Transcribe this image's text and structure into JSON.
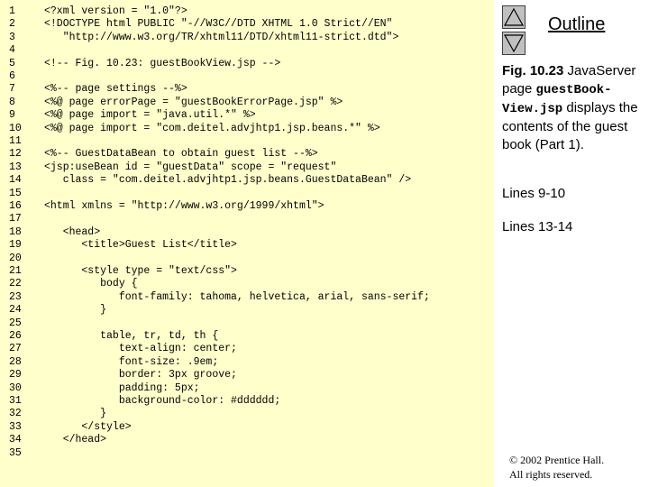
{
  "code": {
    "lines": [
      {
        "n": "1",
        "t": "<?xml version = \"1.0\"?>"
      },
      {
        "n": "2",
        "t": "<!DOCTYPE html PUBLIC \"-//W3C//DTD XHTML 1.0 Strict//EN\""
      },
      {
        "n": "3",
        "t": "   \"http://www.w3.org/TR/xhtml11/DTD/xhtml11-strict.dtd\">"
      },
      {
        "n": "4",
        "t": ""
      },
      {
        "n": "5",
        "t": "<!-- Fig. 10.23: guestBookView.jsp -->"
      },
      {
        "n": "6",
        "t": ""
      },
      {
        "n": "7",
        "t": "<%-- page settings --%>"
      },
      {
        "n": "8",
        "t": "<%@ page errorPage = \"guestBookErrorPage.jsp\" %>"
      },
      {
        "n": "9",
        "t": "<%@ page import = \"java.util.*\" %>"
      },
      {
        "n": "10",
        "t": "<%@ page import = \"com.deitel.advjhtp1.jsp.beans.*\" %>"
      },
      {
        "n": "11",
        "t": ""
      },
      {
        "n": "12",
        "t": "<%-- GuestDataBean to obtain guest list --%>"
      },
      {
        "n": "13",
        "t": "<jsp:useBean id = \"guestData\" scope = \"request\""
      },
      {
        "n": "14",
        "t": "   class = \"com.deitel.advjhtp1.jsp.beans.GuestDataBean\" />"
      },
      {
        "n": "15",
        "t": ""
      },
      {
        "n": "16",
        "t": "<html xmlns = \"http://www.w3.org/1999/xhtml\">"
      },
      {
        "n": "17",
        "t": ""
      },
      {
        "n": "18",
        "t": "   <head>"
      },
      {
        "n": "19",
        "t": "      <title>Guest List</title>"
      },
      {
        "n": "20",
        "t": ""
      },
      {
        "n": "21",
        "t": "      <style type = \"text/css\">"
      },
      {
        "n": "22",
        "t": "         body {"
      },
      {
        "n": "23",
        "t": "            font-family: tahoma, helvetica, arial, sans-serif;"
      },
      {
        "n": "24",
        "t": "         }"
      },
      {
        "n": "25",
        "t": ""
      },
      {
        "n": "26",
        "t": "         table, tr, td, th {"
      },
      {
        "n": "27",
        "t": "            text-align: center;"
      },
      {
        "n": "28",
        "t": "            font-size: .9em;"
      },
      {
        "n": "29",
        "t": "            border: 3px groove;"
      },
      {
        "n": "30",
        "t": "            padding: 5px;"
      },
      {
        "n": "31",
        "t": "            background-color: #dddddd;"
      },
      {
        "n": "32",
        "t": "         }"
      },
      {
        "n": "33",
        "t": "      </style>"
      },
      {
        "n": "34",
        "t": "   </head>"
      },
      {
        "n": "35",
        "t": ""
      }
    ]
  },
  "sidebar": {
    "outline_title": "Outline",
    "up_icon": "triangle-up-icon",
    "down_icon": "triangle-down-icon",
    "caption": {
      "fig": "Fig. 10.23",
      "text1": " JavaServer page ",
      "mono": "guestBook-View.jsp",
      "text2": " displays the contents of the guest book (Part 1)."
    },
    "notes": [
      "Lines 9-10",
      "Lines 13-14"
    ],
    "copyright_line1": "© 2002 Prentice Hall.",
    "copyright_line2": "All rights reserved."
  },
  "colors": {
    "code_background": "#ffffcc",
    "nav_button": "#c0c0c0"
  }
}
